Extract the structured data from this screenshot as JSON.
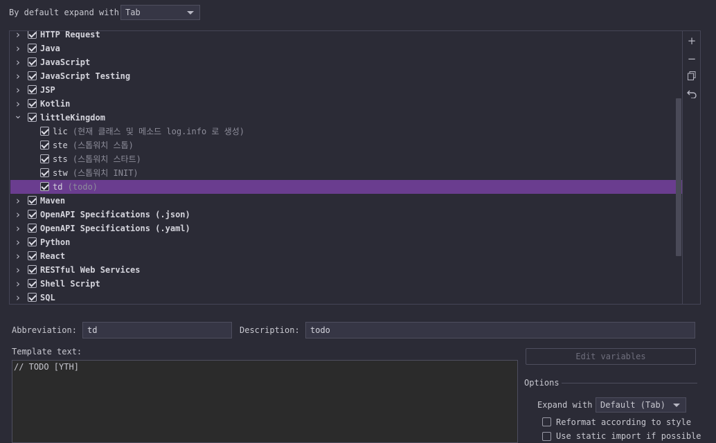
{
  "expand": {
    "label": "By default expand with",
    "value": "Tab"
  },
  "tree": {
    "rows": [
      {
        "type": "group",
        "label": "HTTP Request",
        "desc": "",
        "checked": true,
        "expanded": false,
        "selected": false
      },
      {
        "type": "group",
        "label": "Java",
        "desc": "",
        "checked": true,
        "expanded": false,
        "selected": false
      },
      {
        "type": "group",
        "label": "JavaScript",
        "desc": "",
        "checked": true,
        "expanded": false,
        "selected": false
      },
      {
        "type": "group",
        "label": "JavaScript Testing",
        "desc": "",
        "checked": true,
        "expanded": false,
        "selected": false
      },
      {
        "type": "group",
        "label": "JSP",
        "desc": "",
        "checked": true,
        "expanded": false,
        "selected": false
      },
      {
        "type": "group",
        "label": "Kotlin",
        "desc": "",
        "checked": true,
        "expanded": false,
        "selected": false
      },
      {
        "type": "group",
        "label": "littleKingdom",
        "desc": "",
        "checked": true,
        "expanded": true,
        "selected": false
      },
      {
        "type": "item",
        "label": "lic",
        "desc": "(현재 클래스 및 메소드 log.info 로 생성)",
        "checked": true,
        "selected": false
      },
      {
        "type": "item",
        "label": "ste",
        "desc": "(스톱워치 스톱)",
        "checked": true,
        "selected": false
      },
      {
        "type": "item",
        "label": "sts",
        "desc": "(스톱워치 스타트)",
        "checked": true,
        "selected": false
      },
      {
        "type": "item",
        "label": "stw",
        "desc": "(스톱워치 INIT)",
        "checked": true,
        "selected": false
      },
      {
        "type": "item",
        "label": "td",
        "desc": "(todo)",
        "checked": true,
        "selected": true
      },
      {
        "type": "group",
        "label": "Maven",
        "desc": "",
        "checked": true,
        "expanded": false,
        "selected": false
      },
      {
        "type": "group",
        "label": "OpenAPI Specifications (.json)",
        "desc": "",
        "checked": true,
        "expanded": false,
        "selected": false
      },
      {
        "type": "group",
        "label": "OpenAPI Specifications (.yaml)",
        "desc": "",
        "checked": true,
        "expanded": false,
        "selected": false
      },
      {
        "type": "group",
        "label": "Python",
        "desc": "",
        "checked": true,
        "expanded": false,
        "selected": false
      },
      {
        "type": "group",
        "label": "React",
        "desc": "",
        "checked": true,
        "expanded": false,
        "selected": false
      },
      {
        "type": "group",
        "label": "RESTful Web Services",
        "desc": "",
        "checked": true,
        "expanded": false,
        "selected": false
      },
      {
        "type": "group",
        "label": "Shell Script",
        "desc": "",
        "checked": true,
        "expanded": false,
        "selected": false
      },
      {
        "type": "group",
        "label": "SQL",
        "desc": "",
        "checked": true,
        "expanded": false,
        "selected": false
      }
    ]
  },
  "toolbar": {
    "add_icon": "plus-icon",
    "remove_icon": "minus-icon",
    "copy_icon": "copy-icon",
    "revert_icon": "undo-icon"
  },
  "abbreviation": {
    "label": "Abbreviation:",
    "value": "td"
  },
  "description": {
    "label": "Description:",
    "value": "todo"
  },
  "template": {
    "label": "Template text:",
    "text": "// TODO [YTH]"
  },
  "edit_variables": {
    "label": "Edit variables"
  },
  "options": {
    "title": "Options",
    "expand_label": "Expand with",
    "expand_value": "Default (Tab)",
    "reformat_label": "Reformat according to style",
    "static_import_label": "Use static import if possible"
  },
  "colors": {
    "selection": "#6a3d8f",
    "background": "#2b2b36"
  }
}
